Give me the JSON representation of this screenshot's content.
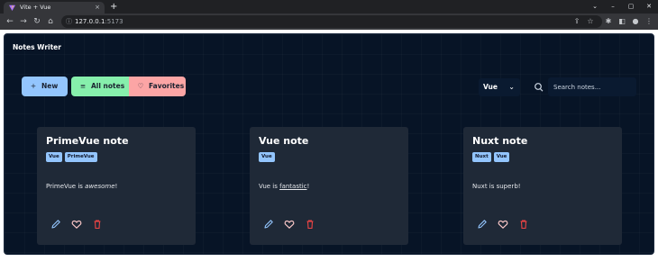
{
  "browser": {
    "tab_title": "Vite + Vue",
    "tab_close": "×",
    "new_tab": "+",
    "url_host": "127.0.0.1",
    "url_port": ":5173",
    "info_glyph": "ⓘ",
    "icons": [
      "back-icon",
      "forward-icon",
      "reload-icon",
      "home-icon",
      "share-icon",
      "star-icon",
      "extensions-icon",
      "sidepanel-icon",
      "profile-icon",
      "menu-icon"
    ],
    "window_controls": [
      "⌄",
      "–",
      "▢",
      "✕"
    ]
  },
  "app": {
    "title": "Notes Writer",
    "buttons": {
      "new_label": "New",
      "all_label": "All notes",
      "favorites_label": "Favorites"
    },
    "filter": {
      "selected": "Vue"
    },
    "search": {
      "placeholder": "Search notes..."
    },
    "notes": [
      {
        "title": "PrimeVue note",
        "tags": [
          "Vue",
          "PrimeVue"
        ],
        "body_pre": "PrimeVue is ",
        "body_em": "awesome",
        "body_post": "!"
      },
      {
        "title": "Vue note",
        "tags": [
          "Vue"
        ],
        "body_pre": "Vue is ",
        "body_em": "fantastic",
        "body_post": "!"
      },
      {
        "title": "Nuxt note",
        "tags": [
          "Nuxt",
          "Vue"
        ],
        "body_pre": "Nuxt is superb!",
        "body_em": "",
        "body_post": ""
      }
    ],
    "colors": {
      "background": "#071426",
      "card": "#1f2937",
      "new_button": "#93c5fd",
      "all_button": "#86efac",
      "favorites_button": "#fca5a5",
      "edit_icon": "#93c5fd",
      "favorite_icon": "#fecaca",
      "delete_icon": "#ef4444"
    }
  }
}
